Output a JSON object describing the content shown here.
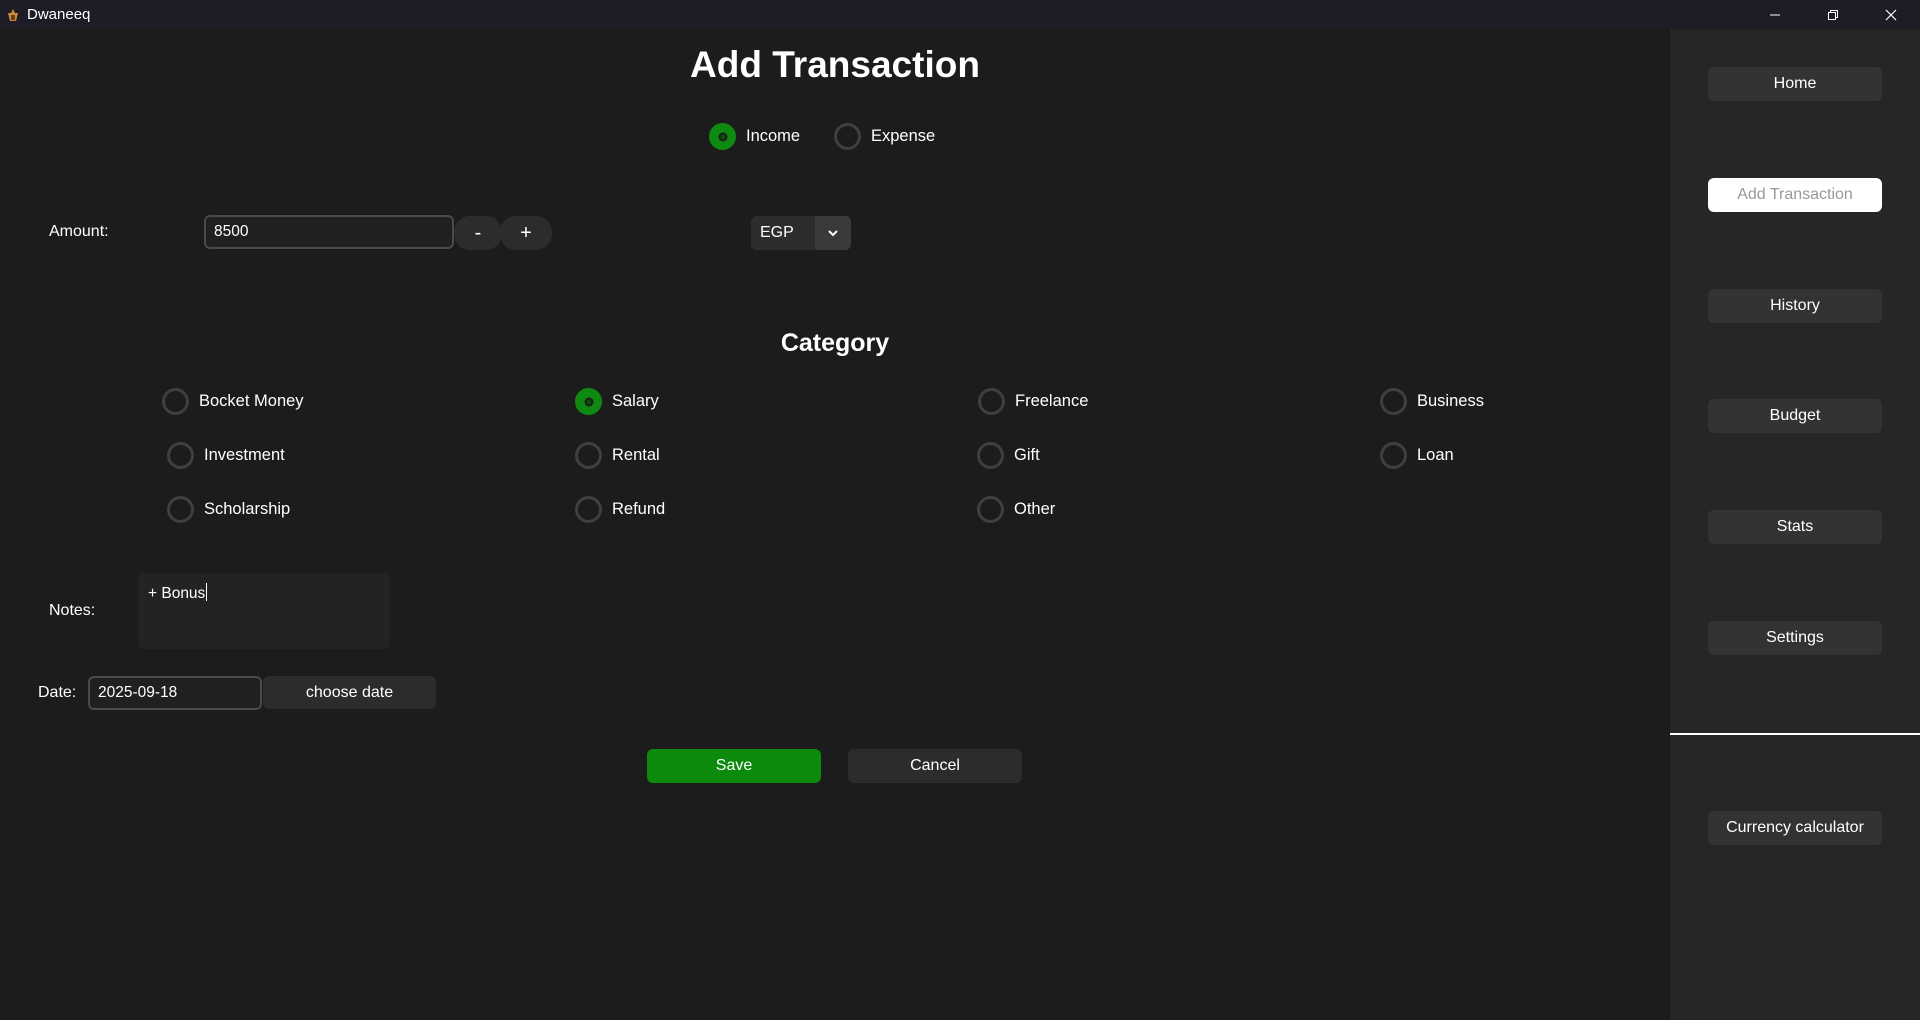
{
  "window": {
    "title": "Dwaneeq",
    "controls": [
      "minimize-icon",
      "restore-icon",
      "close-icon"
    ]
  },
  "page": {
    "title": "Add Transaction"
  },
  "type_options": [
    {
      "label": "Income",
      "selected": true
    },
    {
      "label": "Expense",
      "selected": false
    }
  ],
  "amount": {
    "label": "Amount:",
    "value": "8500",
    "decrement_label": "-",
    "increment_label": "+",
    "currency": "EGP"
  },
  "category": {
    "title": "Category",
    "options": [
      {
        "label": "Bocket Money",
        "selected": false
      },
      {
        "label": "Salary",
        "selected": true
      },
      {
        "label": "Freelance",
        "selected": false
      },
      {
        "label": "Business",
        "selected": false
      },
      {
        "label": "Investment",
        "selected": false
      },
      {
        "label": "Rental",
        "selected": false
      },
      {
        "label": "Gift",
        "selected": false
      },
      {
        "label": "Loan",
        "selected": false
      },
      {
        "label": "Scholarship",
        "selected": false
      },
      {
        "label": "Refund",
        "selected": false
      },
      {
        "label": "Other",
        "selected": false
      }
    ]
  },
  "notes": {
    "label": "Notes:",
    "value": "+ Bonus"
  },
  "date": {
    "label": "Date:",
    "value": "2025-09-18",
    "button_label": "choose date"
  },
  "actions": {
    "save_label": "Save",
    "cancel_label": "Cancel"
  },
  "sidebar": {
    "items": [
      {
        "label": "Home",
        "active": false
      },
      {
        "label": "Add Transaction",
        "active": true
      },
      {
        "label": "History",
        "active": false
      },
      {
        "label": "Budget",
        "active": false
      },
      {
        "label": "Stats",
        "active": false
      },
      {
        "label": "Settings",
        "active": false
      }
    ],
    "bottom_item": {
      "label": "Currency calculator"
    }
  },
  "colors": {
    "accent_green": "#0b8a0c",
    "background": "#1c1c1c",
    "sidebar_background": "#262626"
  }
}
